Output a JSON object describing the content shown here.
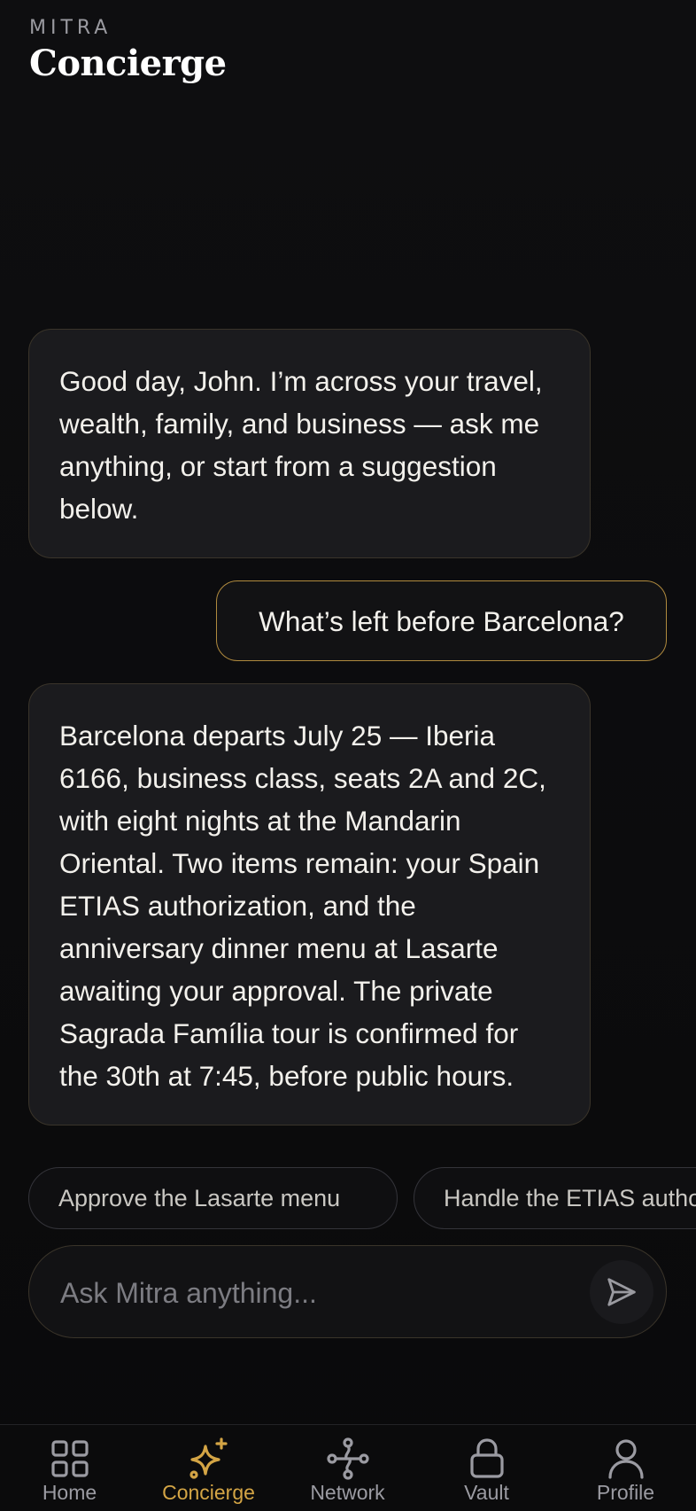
{
  "header": {
    "brand": "MITRA",
    "title": "Concierge"
  },
  "messages": [
    {
      "role": "assistant",
      "text": "Good day, John. I’m across your travel, wealth, family, and business — ask me anything, or start from a suggestion below."
    },
    {
      "role": "user",
      "text": "What’s left before Barcelona?"
    },
    {
      "role": "assistant",
      "text": "Barcelona departs July 25 — Iberia 6166, business class, seats 2A and 2C, with eight nights at the Mandarin Oriental. Two items remain: your Spain ETIAS authorization, and the anniversary dinner menu at Lasarte awaiting your approval. The private Sagrada Família tour is confirmed for the 30th at 7:45, before public hours."
    }
  ],
  "suggestions": [
    "Approve the Lasarte menu",
    "Handle the ETIAS authorization"
  ],
  "composer": {
    "placeholder": "Ask Mitra anything...",
    "send_icon": "send-icon"
  },
  "tabs": [
    {
      "label": "Home",
      "icon": "grid-icon",
      "active": false
    },
    {
      "label": "Concierge",
      "icon": "sparkle-icon",
      "active": true
    },
    {
      "label": "Network",
      "icon": "network-icon",
      "active": false
    },
    {
      "label": "Vault",
      "icon": "lock-icon",
      "active": false
    },
    {
      "label": "Profile",
      "icon": "person-icon",
      "active": false
    }
  ],
  "colors": {
    "accent": "#d4a545",
    "background": "#0b0b0c",
    "bubble": "#1b1b1e",
    "inactive": "#9b9ba2"
  }
}
